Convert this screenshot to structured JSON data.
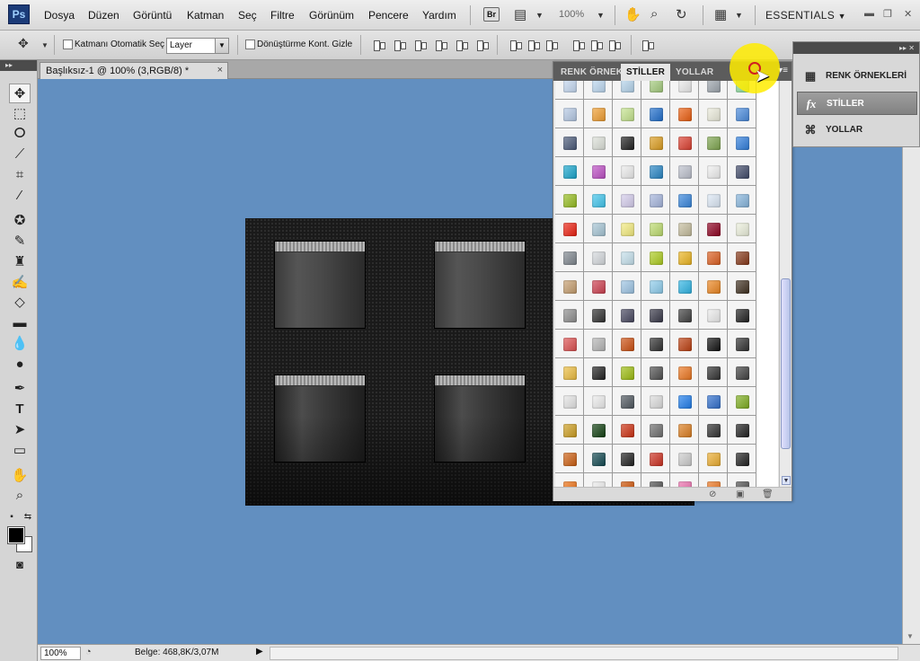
{
  "app": {
    "logo": "Ps",
    "menu": [
      "Dosya",
      "Düzen",
      "Görüntü",
      "Katman",
      "Seç",
      "Filtre",
      "Görünüm",
      "Pencere",
      "Yardım"
    ],
    "bridge_label": "Br",
    "zoom_level": "100%",
    "workspace": "ESSENTIALS",
    "workspace_arrow": "▼"
  },
  "options": {
    "auto_select_label": "Katmanı Otomatik Seç",
    "auto_select_target": "Layer",
    "transform_controls_label": "Dönüştürme Kont. Gizle"
  },
  "document": {
    "tab_title": "Başlıksız-1 @ 100% (3,RGB/8) *",
    "close_symbol": "×"
  },
  "status": {
    "zoom": "100%",
    "doc_info": "Belge: 468,8K/3,07M",
    "arrow": "▶"
  },
  "styles_panel": {
    "tabs": [
      "RENK ÖRNEKL",
      "STİLLER",
      "YOLLAR"
    ],
    "active_tab": 1,
    "swatches": [
      "#c8dcf5",
      "#c0dcf5",
      "#b8d8f0",
      "#a8d080",
      "#f0f0f0",
      "#a0a8b0",
      "#90e0a0",
      "#b8cce8",
      "#f4a030",
      "#c8e890",
      "#2070d0",
      "#f06010",
      "#f0f0e0",
      "#4a8ce0",
      "#4a5a7a",
      "#e0e4dc",
      "#202020",
      "#e0a020",
      "#e04030",
      "#80a850",
      "#3080e0",
      "#18a8d0",
      "#c050c8",
      "#f0f0f0",
      "#2888c8",
      "#c0c4d0",
      "#f4f4f4",
      "#404a6a",
      "#98c020",
      "#40c8f0",
      "#d8d0f0",
      "#a8b8e0",
      "#3888e0",
      "#e0ecfa",
      "#88b8e0",
      "#f02010",
      "#a8c8d8",
      "#f8f080",
      "#c0e070",
      "#c8c0a0",
      "#900020",
      "#f0f4e0",
      "#808890",
      "#d8dce0",
      "#c8e4f0",
      "#b0d020",
      "#f0b820",
      "#e06020",
      "#883818",
      "#c8a070",
      "#d04050",
      "#a0c8e8",
      "#90d0f0",
      "#30b8e8",
      "#f08820",
      "#403020",
      "#909090",
      "#303030",
      "#484860",
      "#383848",
      "#404040",
      "#f0f0f0",
      "#202020",
      "#e05050",
      "#b8b8b8",
      "#d05010",
      "#303030",
      "#c04010",
      "#101010",
      "#303030",
      "#f0c040",
      "#202020",
      "#a0c010",
      "#505050",
      "#f07820",
      "#303030",
      "#404040",
      "#e8e8e8",
      "#f0f0f0",
      "#505860",
      "#e0e0e0",
      "#2080f0",
      "#3070d0",
      "#80b020",
      "#d0a020",
      "#104010",
      "#d03010",
      "#707070",
      "#e08020",
      "#303030",
      "#202020",
      "#d06010",
      "#104850",
      "#202020",
      "#d03020",
      "#d0d0d0",
      "#f0b030",
      "#202020",
      "#f07010",
      "#f0f0f0",
      "#d05000",
      "#505050",
      "#f070b0",
      "#f07820",
      "#505050"
    ]
  },
  "dock": {
    "items": [
      "RENK ÖRNEKLERİ",
      "STİLLER",
      "YOLLAR"
    ],
    "active": 1
  }
}
